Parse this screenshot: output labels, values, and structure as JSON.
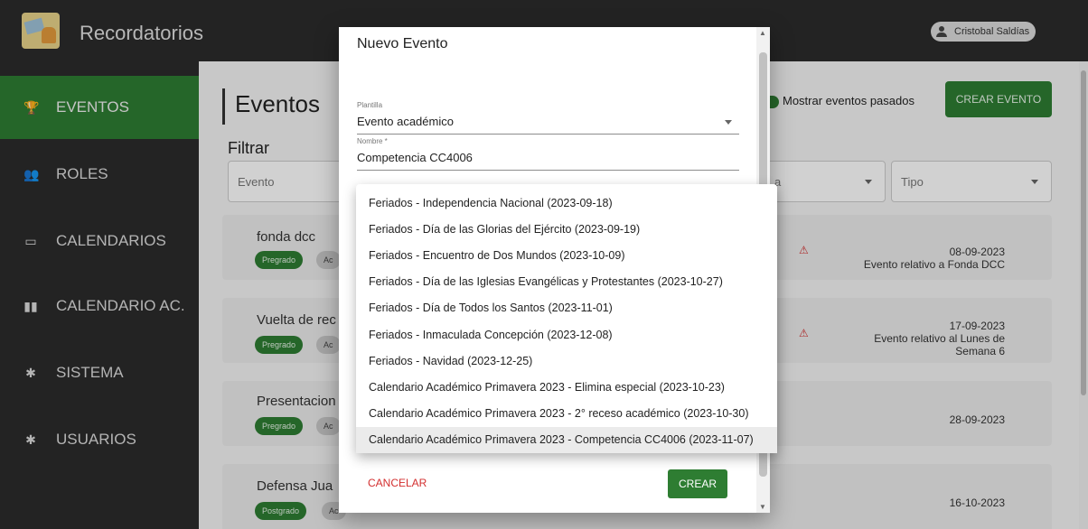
{
  "app": {
    "title": "Recordatorios",
    "user_name": "Cristobal Saldías"
  },
  "sidebar": {
    "items": [
      {
        "label": "EVENTOS",
        "icon": "trophy-icon",
        "glyph": "🏆"
      },
      {
        "label": "ROLES",
        "icon": "people-icon",
        "glyph": "👥"
      },
      {
        "label": "CALENDARIOS",
        "icon": "calendar-icon",
        "glyph": "▭"
      },
      {
        "label": "CALENDARIO AC.",
        "icon": "book-icon",
        "glyph": "▮▮"
      },
      {
        "label": "SISTEMA",
        "icon": "gear-icon",
        "glyph": "✱"
      },
      {
        "label": "USUARIOS",
        "icon": "gear-icon",
        "glyph": "✱"
      }
    ]
  },
  "main": {
    "title": "Eventos",
    "show_past_label": "Mostrar eventos pasados",
    "create_button": "CREAR EVENTO",
    "filter": {
      "title": "Filtrar",
      "event_placeholder": "Evento",
      "category_placeholder": "a",
      "type_placeholder": "Tipo"
    },
    "cards": [
      {
        "title": "fonda dcc",
        "chips": [
          "Pregrado",
          "Ac"
        ],
        "date": "08-09-2023",
        "note": "Evento relativo a Fonda DCC"
      },
      {
        "title": "Vuelta de rec",
        "chips": [
          "Pregrado",
          "Ac"
        ],
        "date": "17-09-2023",
        "note": "Evento relativo al Lunes de Semana 6"
      },
      {
        "title": "Presentacion",
        "chips": [
          "Pregrado",
          "Ac"
        ],
        "date": "28-09-2023",
        "note": ""
      },
      {
        "title": "Defensa Jua",
        "chips": [
          "Postgrado",
          "Ac"
        ],
        "date": "16-10-2023",
        "note": ""
      }
    ]
  },
  "dialog": {
    "title": "Nuevo Evento",
    "template_label": "Plantilla",
    "template_value": "Evento académico",
    "name_label": "Nombre *",
    "name_value": "Competencia CC4006",
    "cancel_label": "CANCELAR",
    "confirm_label": "CREAR"
  },
  "dropdown": {
    "options": [
      "Feriados - Independencia Nacional (2023-09-18)",
      "Feriados - Día de las Glorias del Ejército (2023-09-19)",
      "Feriados - Encuentro de Dos Mundos (2023-10-09)",
      "Feriados - Día de las Iglesias Evangélicas y Protestantes (2023-10-27)",
      "Feriados - Día de Todos los Santos (2023-11-01)",
      "Feriados - Inmaculada Concepción (2023-12-08)",
      "Feriados - Navidad (2023-12-25)",
      "Calendario Académico Primavera 2023 - Elimina especial (2023-10-23)",
      "Calendario Académico Primavera 2023 - 2° receso académico (2023-10-30)",
      "Calendario Académico Primavera 2023 - Competencia CC4006 (2023-11-07)"
    ],
    "selected_index": 9
  },
  "colors": {
    "accent": "#2e7d32",
    "sidebar_bg": "#2b2b2b",
    "danger": "#d32f2f"
  }
}
